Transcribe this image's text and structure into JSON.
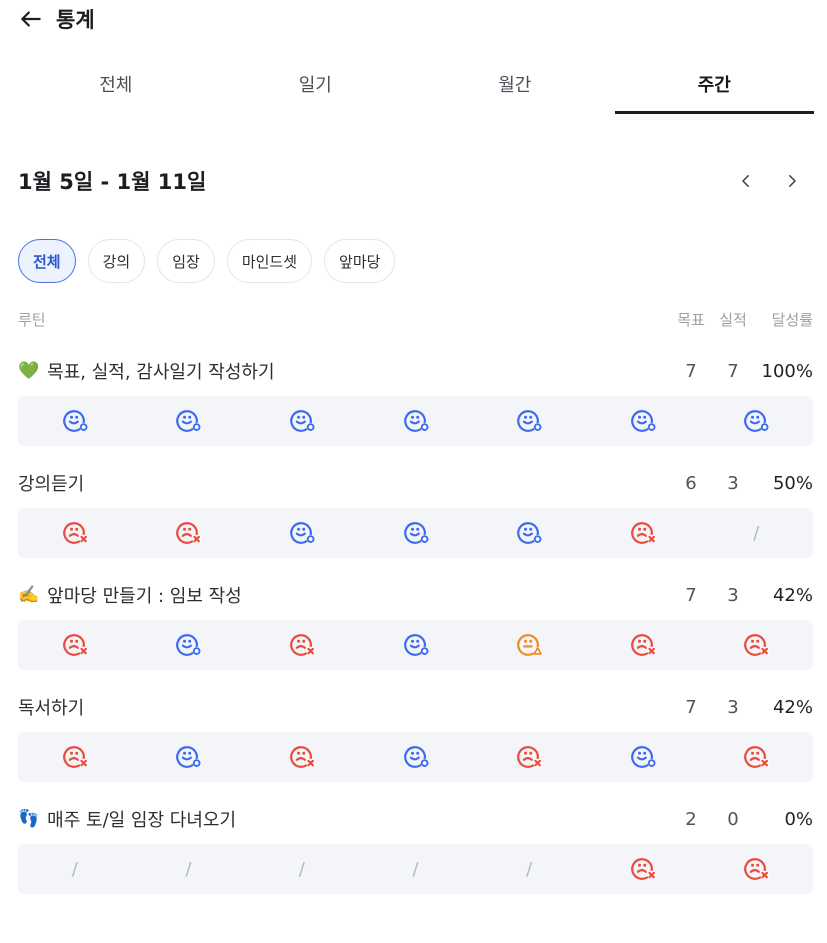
{
  "header": {
    "title": "통계",
    "back_icon": "arrow-left-icon"
  },
  "tabs": [
    {
      "label": "전체",
      "active": false
    },
    {
      "label": "일기",
      "active": false
    },
    {
      "label": "월간",
      "active": false
    },
    {
      "label": "주간",
      "active": true
    }
  ],
  "period": {
    "range": "1월 5일 - 1월 11일",
    "prev_icon": "chevron-left-icon",
    "next_icon": "chevron-right-icon"
  },
  "filters": [
    {
      "label": "전체",
      "active": true
    },
    {
      "label": "강의",
      "active": false
    },
    {
      "label": "임장",
      "active": false
    },
    {
      "label": "마인드셋",
      "active": false
    },
    {
      "label": "앞마당",
      "active": false
    }
  ],
  "columns": {
    "routine": "루틴",
    "goal": "목표",
    "actual": "실적",
    "rate": "달성률"
  },
  "colors": {
    "success": "#3b6af0",
    "fail": "#ea4a3b",
    "warning": "#f08a24",
    "active_tab": "#1c1e22",
    "chip_active": "#4a73e6"
  },
  "routines": [
    {
      "emoji": "💚",
      "name": "목표, 실적, 감사일기 작성하기",
      "goal": "7",
      "actual": "7",
      "rate": "100%",
      "days": [
        "success",
        "success",
        "success",
        "success",
        "success",
        "success",
        "success"
      ]
    },
    {
      "emoji": "",
      "name": "강의듣기",
      "goal": "6",
      "actual": "3",
      "rate": "50%",
      "days": [
        "fail",
        "fail",
        "success",
        "success",
        "success",
        "fail",
        "none"
      ]
    },
    {
      "emoji": "✍️",
      "name": "앞마당 만들기 : 임보 작성",
      "goal": "7",
      "actual": "3",
      "rate": "42%",
      "days": [
        "fail",
        "success",
        "fail",
        "success",
        "warning",
        "fail",
        "fail"
      ]
    },
    {
      "emoji": "",
      "name": "독서하기",
      "goal": "7",
      "actual": "3",
      "rate": "42%",
      "days": [
        "fail",
        "success",
        "fail",
        "success",
        "fail",
        "success",
        "fail"
      ]
    },
    {
      "emoji": "👣",
      "name": "매주 토/일 임장 다녀오기",
      "goal": "2",
      "actual": "0",
      "rate": "0%",
      "days": [
        "none",
        "none",
        "none",
        "none",
        "none",
        "fail",
        "fail"
      ]
    }
  ],
  "empty_mark": "/"
}
